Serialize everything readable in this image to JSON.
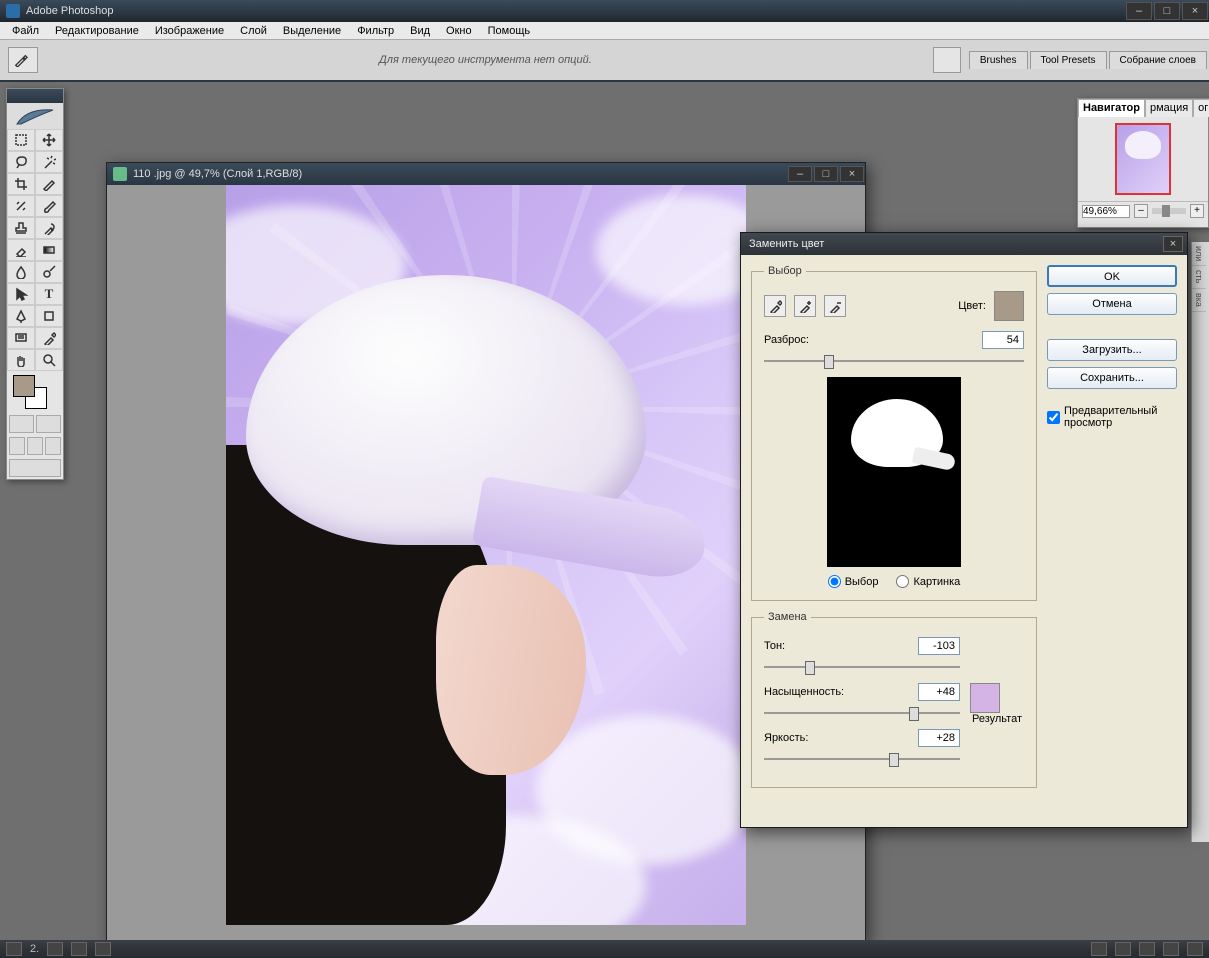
{
  "app": {
    "title": "Adobe Photoshop"
  },
  "menu": [
    "Файл",
    "Редактирование",
    "Изображение",
    "Слой",
    "Выделение",
    "Фильтр",
    "Вид",
    "Окно",
    "Помощь"
  ],
  "options": {
    "no_options_text": "Для текущего инструмента нет опций.",
    "tabs": [
      "Brushes",
      "Tool Presets",
      "Собрание слоев"
    ]
  },
  "document": {
    "title": "110  .jpg @ 49,7% (Слой 1,RGB/8)"
  },
  "navigator": {
    "tabs": [
      "Навигатор",
      "рмация",
      "огра"
    ],
    "zoom": "49,66%"
  },
  "right_stub_tabs": [
    "или",
    "сть",
    "вка"
  ],
  "dialog": {
    "title": "Заменить цвет",
    "selection_legend": "Выбор",
    "color_label": "Цвет:",
    "color_swatch": "#a89a88",
    "fuzziness_label": "Разброс:",
    "fuzziness_value": "54",
    "radio_selection": "Выбор",
    "radio_image": "Картинка",
    "replace_legend": "Замена",
    "hue_label": "Тон:",
    "hue_value": "-103",
    "sat_label": "Насыщенность:",
    "sat_value": "+48",
    "light_label": "Яркость:",
    "light_value": "+28",
    "result_label": "Результат",
    "result_swatch": "#d3b4e5",
    "ok": "OK",
    "cancel": "Отмена",
    "load": "Загрузить...",
    "save": "Сохранить...",
    "preview_checkbox": "Предварительный просмотр"
  },
  "status": {
    "doc_num": "2."
  },
  "tool_icons": [
    "marquee",
    "move",
    "lasso",
    "wand",
    "crop",
    "slice",
    "heal",
    "brush",
    "stamp",
    "history",
    "eraser",
    "gradient",
    "blur",
    "dodge",
    "path",
    "type",
    "pen",
    "shape",
    "notes",
    "eyedrop",
    "hand",
    "zoom"
  ]
}
